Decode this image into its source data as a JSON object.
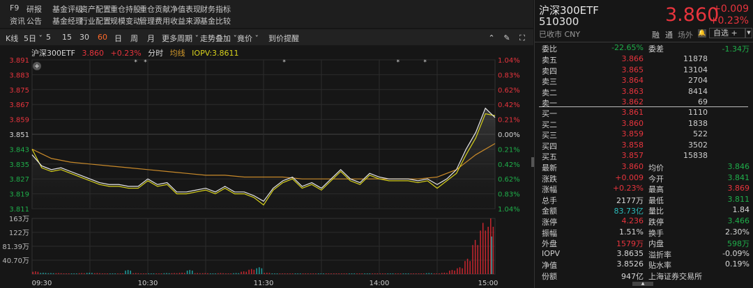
{
  "nav": {
    "row1": [
      "F9",
      "研报",
      "基金评级",
      "资产配置",
      "重仓持股",
      "重仓贡献",
      "净值表现",
      "财务指标"
    ],
    "row2": [
      "资讯",
      "公告",
      "基金经理",
      "行业配置",
      "规模变动",
      "管理费用",
      "收益来源",
      "基金比较"
    ]
  },
  "toolbar": {
    "items": [
      "K线",
      "5日 ˇ",
      "5",
      "15",
      "30",
      "60",
      "日",
      "周",
      "月",
      "更多周期 ˇ",
      "走势叠加 ˇ",
      "竟价 ˇ",
      "到价提醒"
    ],
    "active": "60",
    "icons": [
      "collapse-up-icon",
      "brush-icon",
      "fullscreen-icon"
    ]
  },
  "chart_header": {
    "name": "沪深300ETF",
    "price": "3.860",
    "change_pct": "+0.23%",
    "mode": "分时",
    "avg_label": "均线",
    "iopv": "IOPV:3.8611"
  },
  "colors": {
    "up": "#e8343d",
    "down": "#1fae4a",
    "price_line": "#e6e6e6",
    "iopv_line": "#d8d21c",
    "avg_line": "#c98a2a",
    "volume_up": "#c8262f",
    "volume_down": "#1f9d9d"
  },
  "chart_data": [
    {
      "type": "line",
      "title": "沪深300ETF 分时",
      "y_ticks_left": [
        "3.891",
        "3.883",
        "3.875",
        "3.867",
        "3.859",
        "3.851",
        "3.843",
        "3.835",
        "3.827",
        "3.819",
        "3.811"
      ],
      "y_ticks_right": [
        "1.04%",
        "0.83%",
        "0.62%",
        "0.42%",
        "0.21%",
        "0.00%",
        "0.21%",
        "0.42%",
        "0.62%",
        "0.83%",
        "1.04%"
      ],
      "ylim": [
        3.811,
        3.891
      ],
      "prev_close": 3.851,
      "x_minutes": [
        0,
        240
      ],
      "x_labels": [
        "09:30",
        "10:30",
        "11:30",
        "14:00",
        "15:00"
      ],
      "series": [
        {
          "name": "价格",
          "step_minutes": 5,
          "values": [
            3.84,
            3.834,
            3.832,
            3.833,
            3.831,
            3.829,
            3.827,
            3.825,
            3.824,
            3.824,
            3.823,
            3.823,
            3.827,
            3.824,
            3.825,
            3.82,
            3.82,
            3.821,
            3.822,
            3.82,
            3.823,
            3.82,
            3.82,
            3.818,
            3.815,
            3.822,
            3.826,
            3.828,
            3.823,
            3.825,
            3.822,
            3.827,
            3.832,
            3.827,
            3.825,
            3.83,
            3.828,
            3.827,
            3.827,
            3.827,
            3.826,
            3.827,
            3.824,
            3.827,
            3.832,
            3.843,
            3.852,
            3.865,
            3.86
          ]
        },
        {
          "name": "IOPV",
          "step_minutes": 5,
          "values": [
            3.843,
            3.833,
            3.831,
            3.832,
            3.83,
            3.828,
            3.826,
            3.824,
            3.823,
            3.823,
            3.822,
            3.822,
            3.826,
            3.823,
            3.824,
            3.819,
            3.819,
            3.82,
            3.821,
            3.819,
            3.822,
            3.819,
            3.819,
            3.817,
            3.813,
            3.821,
            3.825,
            3.827,
            3.822,
            3.824,
            3.821,
            3.826,
            3.831,
            3.826,
            3.824,
            3.829,
            3.827,
            3.826,
            3.826,
            3.826,
            3.825,
            3.826,
            3.822,
            3.826,
            3.83,
            3.84,
            3.849,
            3.862,
            3.861
          ]
        },
        {
          "name": "均线",
          "step_minutes": 10,
          "values": [
            3.843,
            3.838,
            3.836,
            3.835,
            3.834,
            3.833,
            3.832,
            3.831,
            3.83,
            3.829,
            3.829,
            3.828,
            3.828,
            3.828,
            3.827,
            3.827,
            3.827,
            3.827,
            3.827,
            3.827,
            3.827,
            3.828,
            3.832,
            3.84,
            3.846
          ]
        }
      ],
      "event_markers_minutes": [
        54,
        59,
        131,
        190,
        204
      ]
    },
    {
      "type": "bar",
      "title": "成交量",
      "y_ticks": [
        "163万",
        "122万",
        "81.39万",
        "40.70万"
      ],
      "ylim": [
        0,
        163
      ],
      "unit": "万",
      "step_minutes": 4,
      "values": [
        8,
        4,
        3,
        3,
        2,
        2,
        3,
        4,
        3,
        2,
        2,
        2,
        12,
        3,
        2,
        2,
        2,
        3,
        3,
        4,
        12,
        3,
        3,
        2,
        3,
        2,
        3,
        8,
        15,
        20,
        4,
        2,
        2,
        2,
        2,
        2,
        2,
        2,
        2,
        2,
        2,
        2,
        2,
        2,
        2,
        2,
        2,
        2,
        2,
        2,
        2,
        3,
        2,
        4,
        12,
        20,
        45,
        100,
        150,
        163
      ],
      "directions": [
        "u",
        "d",
        "d",
        "u",
        "u",
        "d",
        "u",
        "d",
        "u",
        "u",
        "d",
        "u",
        "d",
        "u",
        "u",
        "d",
        "u",
        "d",
        "u",
        "u",
        "d",
        "u",
        "u",
        "d",
        "u",
        "u",
        "d",
        "u",
        "u",
        "d",
        "u",
        "d",
        "u",
        "u",
        "d",
        "u",
        "u",
        "d",
        "u",
        "u",
        "u",
        "d",
        "u",
        "d",
        "u",
        "u",
        "d",
        "u",
        "d",
        "u",
        "u",
        "d",
        "u",
        "u",
        "u",
        "u",
        "u",
        "u",
        "u",
        "u"
      ]
    }
  ],
  "quote": {
    "name": "沪深300ETF",
    "code": "510300",
    "status": "已收市 CNY",
    "price": "3.860",
    "change": "+0.009",
    "change_pct": "+0.23%",
    "tags": [
      "融",
      "通",
      "场外"
    ],
    "watch_label": "自选 +"
  },
  "order_book": {
    "ratio": {
      "label": "委比",
      "value": "-22.65%",
      "label2": "委差",
      "value2": "-1.34万"
    },
    "asks": [
      {
        "label": "卖五",
        "price": "3.866",
        "vol": "11878"
      },
      {
        "label": "卖四",
        "price": "3.865",
        "vol": "13104"
      },
      {
        "label": "卖三",
        "price": "3.864",
        "vol": "2704"
      },
      {
        "label": "卖二",
        "price": "3.863",
        "vol": "8414"
      },
      {
        "label": "卖一",
        "price": "3.862",
        "vol": "69"
      }
    ],
    "bids": [
      {
        "label": "买一",
        "price": "3.861",
        "vol": "1110"
      },
      {
        "label": "买二",
        "price": "3.860",
        "vol": "1838"
      },
      {
        "label": "买三",
        "price": "3.859",
        "vol": "522"
      },
      {
        "label": "买四",
        "price": "3.858",
        "vol": "3502"
      },
      {
        "label": "买五",
        "price": "3.857",
        "vol": "15838"
      }
    ]
  },
  "stats": [
    {
      "l1": "最新",
      "v1": "3.860",
      "c1": "red",
      "l2": "均价",
      "v2": "3.846",
      "c2": "green"
    },
    {
      "l1": "涨跌",
      "v1": "+0.009",
      "c1": "red",
      "l2": "今开",
      "v2": "3.841",
      "c2": "green"
    },
    {
      "l1": "涨幅",
      "v1": "+0.23%",
      "c1": "red",
      "l2": "最高",
      "v2": "3.869",
      "c2": "red"
    },
    {
      "l1": "总手",
      "v1": "2177万",
      "c1": "white",
      "l2": "最低",
      "v2": "3.811",
      "c2": "green"
    },
    {
      "l1": "金额",
      "v1": "83.73亿",
      "c1": "teal",
      "l2": "量比",
      "v2": "1.84",
      "c2": "white"
    },
    {
      "l1": "涨停",
      "v1": "4.236",
      "c1": "red",
      "l2": "跌停",
      "v2": "3.466",
      "c2": "green"
    },
    {
      "l1": "振幅",
      "v1": "1.51%",
      "c1": "white",
      "l2": "换手",
      "v2": "2.30%",
      "c2": "white"
    },
    {
      "l1": "外盘",
      "v1": "1579万",
      "c1": "red",
      "l2": "内盘",
      "v2": "598万",
      "c2": "green"
    },
    {
      "l1": "IOPV",
      "v1": "3.8635",
      "c1": "white",
      "l2": "溢折率",
      "v2": "-0.09%",
      "c2": "white"
    },
    {
      "l1": "净值",
      "v1": "3.8526",
      "c1": "white",
      "l2": "贴水率",
      "v2": "0.19%",
      "c2": "white"
    },
    {
      "l1": "份额",
      "v1": "947亿",
      "c1": "white",
      "l2": "上海证券交易所",
      "v2": "",
      "c2": "white"
    }
  ]
}
